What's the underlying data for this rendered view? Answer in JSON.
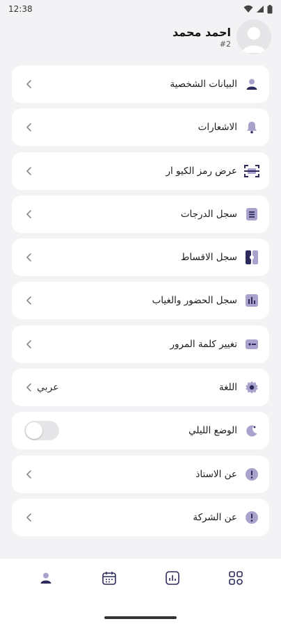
{
  "status_bar": {
    "time": "12:38"
  },
  "profile": {
    "name": "احمد محمد",
    "id": "#2"
  },
  "menu": [
    {
      "name": "personal-data",
      "label": "البيانات الشخصية",
      "icon": "user-icon",
      "trailing": "chevron"
    },
    {
      "name": "notifications",
      "label": "الاشعارات",
      "icon": "bell-icon",
      "trailing": "chevron"
    },
    {
      "name": "qr-code",
      "label": "عرض رمز الكيو ار",
      "icon": "qr-scan-icon",
      "trailing": "chevron"
    },
    {
      "name": "grades-record",
      "label": "سجل الدرجات",
      "icon": "list-doc-icon",
      "trailing": "chevron"
    },
    {
      "name": "installments-record",
      "label": "سجل الاقساط",
      "icon": "ticket-icon",
      "trailing": "chevron"
    },
    {
      "name": "attendance-record",
      "label": "سجل الحضور والغياب",
      "icon": "bar-chart-icon",
      "trailing": "chevron"
    },
    {
      "name": "change-password",
      "label": "تغيير كلمة المرور",
      "icon": "password-icon",
      "trailing": "chevron"
    },
    {
      "name": "language",
      "label": "اللغة",
      "icon": "gear-icon",
      "trailing": "chevron",
      "value": "عربي"
    },
    {
      "name": "night-mode",
      "label": "الوضع الليلي",
      "icon": "moon-icon",
      "trailing": "toggle",
      "toggle_on": false
    },
    {
      "name": "about-teacher",
      "label": "عن الاستاذ",
      "icon": "info-icon",
      "trailing": "chevron"
    },
    {
      "name": "about-company",
      "label": "عن الشركة",
      "icon": "info-icon",
      "trailing": "chevron"
    }
  ],
  "bottom_nav": [
    {
      "name": "profile",
      "icon": "user-icon",
      "active": true
    },
    {
      "name": "calendar",
      "icon": "calendar-icon",
      "active": false
    },
    {
      "name": "stats",
      "icon": "stats-icon",
      "active": false
    },
    {
      "name": "apps",
      "icon": "grid-icon",
      "active": false
    }
  ],
  "colors": {
    "accent": "#2c2a5c",
    "icon_light": "#a9a2cc",
    "background": "#f3f3f5",
    "card": "#ffffff"
  }
}
